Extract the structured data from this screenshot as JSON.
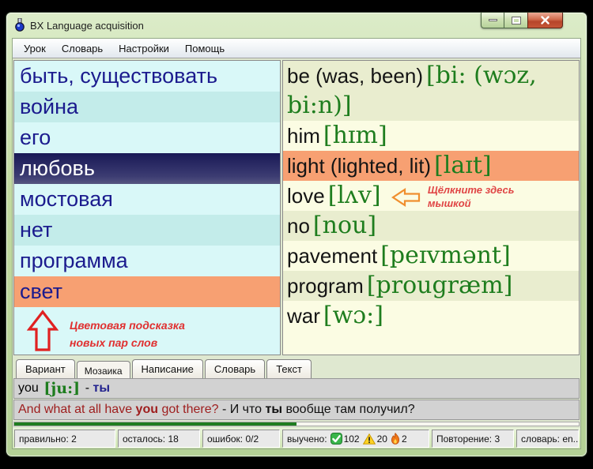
{
  "window": {
    "title": "BX Language acquisition"
  },
  "colors": {
    "selected_row": "#22226a",
    "new_pair_highlight": "#f7a072",
    "transcription_green": "#1e7d1e",
    "annotation_red": "#e03030",
    "progress_green": "#1f7d1f"
  },
  "menu": {
    "items": [
      {
        "label": "Урок"
      },
      {
        "label": "Словарь"
      },
      {
        "label": "Настройки"
      },
      {
        "label": "Помощь"
      }
    ]
  },
  "left_list": {
    "items": [
      {
        "text": "быть, существовать",
        "state": "normal"
      },
      {
        "text": "война",
        "state": "alt"
      },
      {
        "text": "его",
        "state": "normal"
      },
      {
        "text": "любовь",
        "state": "selected"
      },
      {
        "text": "мостовая",
        "state": "normal"
      },
      {
        "text": "нет",
        "state": "alt"
      },
      {
        "text": "программа",
        "state": "normal"
      },
      {
        "text": "свет",
        "state": "new-highlight"
      }
    ]
  },
  "left_annotation": {
    "line1": "Цветовая подсказка",
    "line2": "новых пар слов"
  },
  "right_list": {
    "items": [
      {
        "word": "be (was, been)",
        "transcription": "[bi: (wɔz, bi:n)]",
        "state": "alt"
      },
      {
        "word": "him",
        "transcription": "[hɪm]",
        "state": "normal"
      },
      {
        "word": "light (lighted, lit)",
        "transcription": "[laɪt]",
        "state": "new-highlight"
      },
      {
        "word": "love",
        "transcription": "[lʌv]",
        "state": "normal"
      },
      {
        "word": "no",
        "transcription": "[nou]",
        "state": "alt"
      },
      {
        "word": "pavement",
        "transcription": "[peɪvmənt]",
        "state": "normal"
      },
      {
        "word": "program",
        "transcription": "[prougræm]",
        "state": "alt"
      },
      {
        "word": "war",
        "transcription": "[wɔ:]",
        "state": "normal"
      }
    ]
  },
  "right_annotation": {
    "line1": "Щёлкните здесь",
    "line2": "мышкой"
  },
  "tabs": {
    "items": [
      {
        "label": "Вариант",
        "active": false
      },
      {
        "label": "Мозаика",
        "active": true
      },
      {
        "label": "Написание",
        "active": false
      },
      {
        "label": "Словарь",
        "active": false
      },
      {
        "label": "Текст",
        "active": false
      }
    ]
  },
  "word_bar": {
    "word": "you",
    "transcription": " [ju:] ",
    "separator": "- ",
    "translation": "ты"
  },
  "sentence_bar": {
    "en_pre": "And what at all have ",
    "en_bold": "you",
    "en_post": " got there? ",
    "ru_pre": "- И что ",
    "ru_bold": "ты",
    "ru_post": " вообще там получил?"
  },
  "progress": {
    "percent": 50
  },
  "status_bar": {
    "correct": "правильно: 2",
    "remaining": "осталось: 18",
    "errors": "ошибок: 0/2",
    "learned_label": "выучено:",
    "learned_ok": "102",
    "learned_warn": "20",
    "learned_new": "2",
    "repetition": "Повторение: 3",
    "dictionary": "словарь: en..."
  }
}
